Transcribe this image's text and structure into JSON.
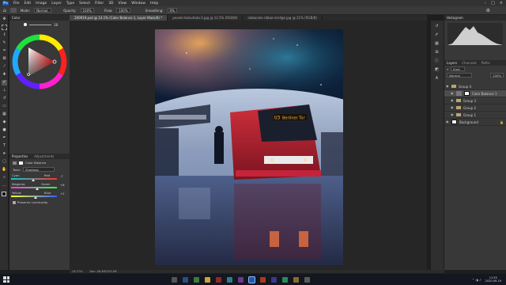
{
  "menu": [
    "Ps",
    "File",
    "Edit",
    "Image",
    "Layer",
    "Type",
    "Select",
    "Filter",
    "3D",
    "View",
    "Window",
    "Help"
  ],
  "options": {
    "mode_label": "Mode:",
    "mode_value": "Normal",
    "opacity_label": "Opacity:",
    "opacity_value": "100%",
    "flow_label": "Flow:",
    "flow_value": "100%",
    "smoothing_label": "Smoothing:",
    "smoothing_value": "0%"
  },
  "tabs": [
    "200919.psd @ 14.1% (Color Balance 1, Layer Mask/8) *",
    "pexels-hatsuhata-3.jpg @ 12.5% (RGB/8)",
    "elaborate-ribbon-bridge.jpg @ 21% (RGB/8)"
  ],
  "color_panel": {
    "title": "Color",
    "value": "18"
  },
  "properties": {
    "title": "Properties",
    "tab2": "Adjustments",
    "subtitle": "Color Balance",
    "tone_label": "Tone:",
    "tone_value": "Shadows",
    "cyan": "Cyan",
    "red": "Red",
    "cyan_value": "-7",
    "magenta": "Magenta",
    "green": "Green",
    "magenta_value": "+8",
    "yellow": "Yellow",
    "blue": "Blue",
    "yellow_value": "+2",
    "preserve": "Preserve Luminosity"
  },
  "histogram": {
    "title": "Histogram"
  },
  "layers": {
    "tabs": [
      "Layers",
      "Channels",
      "Paths"
    ],
    "kind": "Kind",
    "blend": "Normal",
    "opacity": "100%",
    "items": [
      {
        "name": "Group 4",
        "type": "group"
      },
      {
        "name": "Color Balance 1",
        "type": "adjustment"
      },
      {
        "name": "Group 3",
        "type": "group"
      },
      {
        "name": "Group 2",
        "type": "group"
      },
      {
        "name": "Group 1",
        "type": "group"
      },
      {
        "name": "Background",
        "type": "image"
      }
    ]
  },
  "status": {
    "zoom": "14.17%",
    "doc": "Doc: 48.4M/253.4M"
  },
  "sign_text": "Berliner Tor",
  "train_number": "U3",
  "clock": {
    "time": "11:55",
    "date": "2020-09-19"
  },
  "accent": "#3b73d3",
  "chart_data": null
}
